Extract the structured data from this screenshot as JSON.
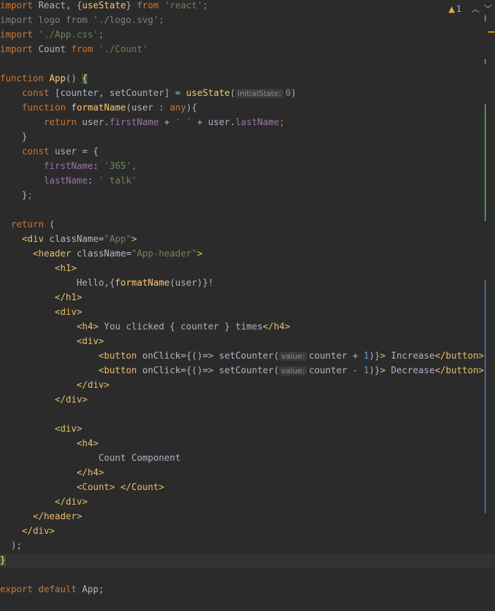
{
  "editor": {
    "inspections": {
      "warning_count": "1",
      "icon": "warning-triangle-icon",
      "prev_icon": "chevron-up-icon",
      "next_icon": "chevron-down-icon"
    },
    "lines": {
      "l1": {
        "a": "import",
        "b": " React, {",
        "c": "useState",
        "d": "} ",
        "e": "from",
        "f": " ",
        "g": "'react'",
        "h": ";"
      },
      "l2": {
        "a": "import logo from './logo.svg';"
      },
      "l3": {
        "a": "import",
        "b": " ",
        "c": "'./App.css'",
        "d": ";"
      },
      "l4": {
        "a": "import",
        "b": " Count ",
        "c": "from",
        "d": " ",
        "e": "'./Count'"
      },
      "l6": {
        "a": "function",
        "b": " ",
        "c": "App",
        "d": "() ",
        "e": "{"
      },
      "l7": {
        "a": "    ",
        "b": "const",
        "c": " [counter, setCounter] = ",
        "d": "useState",
        "e": "(",
        "hint": "initialState:",
        "f": "0",
        "g": ")"
      },
      "l8": {
        "a": "    ",
        "b": "function",
        "c": " ",
        "d": "formatName",
        "e": "(user : ",
        "f": "any",
        "g": "){"
      },
      "l9": {
        "a": "        ",
        "b": "return",
        "c": " user.",
        "d": "firstName",
        "e": " + ",
        "f": "' '",
        "g": " + user.",
        "h": "lastName",
        "i": ";"
      },
      "l10": {
        "a": "    }"
      },
      "l11": {
        "a": "    ",
        "b": "const",
        "c": " user = {"
      },
      "l12": {
        "a": "        ",
        "b": "firstName",
        "c": ": ",
        "d": "'365'",
        "e": ","
      },
      "l13": {
        "a": "        ",
        "b": "lastName",
        "c": ": ",
        "d": "' talk'"
      },
      "l14": {
        "a": "    }",
        "b": ";"
      },
      "l16": {
        "a": "  ",
        "b": "return",
        "c": " ("
      },
      "l17": {
        "a": "    ",
        "b": "<div",
        "c": " className=",
        "d": "\"App\"",
        "e": ">"
      },
      "l18": {
        "a": "      ",
        "b": "<header",
        "c": " className=",
        "d": "\"App-header\"",
        "e": ">"
      },
      "l19": {
        "a": "          ",
        "b": "<h1>"
      },
      "l20": {
        "a": "              Hello,{",
        "b": "formatName",
        "c": "(user)}!"
      },
      "l21": {
        "a": "          ",
        "b": "</h1>"
      },
      "l22": {
        "a": "          ",
        "b": "<div>"
      },
      "l23": {
        "a": "              ",
        "b": "<h4>",
        "c": " You clicked { counter } times",
        "d": "</h4>"
      },
      "l24": {
        "a": "              ",
        "b": "<div>"
      },
      "l25": {
        "a": "                  ",
        "b": "<button",
        "c": " onClick=",
        "d": "{()=> setCounter(",
        "hint": "value:",
        "e": "counter + ",
        "f": "1",
        "g": ")}",
        "h": ">",
        "i": " Increase",
        "j": "</button>"
      },
      "l26": {
        "a": "                  ",
        "b": "<button",
        "c": " onClick=",
        "d": "{()=> setCounter(",
        "hint": "value:",
        "e": "counter - ",
        "f": "1",
        "g": ")}",
        "h": ">",
        "i": " Decrease",
        "j": "</button>"
      },
      "l27": {
        "a": "              ",
        "b": "</div>"
      },
      "l28": {
        "a": "          ",
        "b": "</div>"
      },
      "l30": {
        "a": "          ",
        "b": "<div>"
      },
      "l31": {
        "a": "              ",
        "b": "<h4>"
      },
      "l32": {
        "a": "                  Count Component"
      },
      "l33": {
        "a": "              ",
        "b": "</h4>"
      },
      "l34": {
        "a": "              ",
        "b": "<Count>",
        "c": " ",
        "d": "</Count>"
      },
      "l35": {
        "a": "          ",
        "b": "</div>"
      },
      "l36": {
        "a": "      ",
        "b": "</header>"
      },
      "l37": {
        "a": "    ",
        "b": "</div>"
      },
      "l38": {
        "a": "  );"
      },
      "l39": {
        "a": "}"
      },
      "l41": {
        "a": "export",
        "b": " ",
        "c": "default",
        "d": " App;"
      }
    }
  },
  "colors": {
    "background": "#2b2b2b",
    "keyword": "#cc7832",
    "string": "#6a8759",
    "number": "#6897bb",
    "function": "#ffc66d",
    "property": "#9876aa",
    "tag": "#e8bf6a",
    "default_text": "#a9b7c6",
    "change_marker_green": "#499c54",
    "change_marker_blue": "#3a6fa5"
  }
}
